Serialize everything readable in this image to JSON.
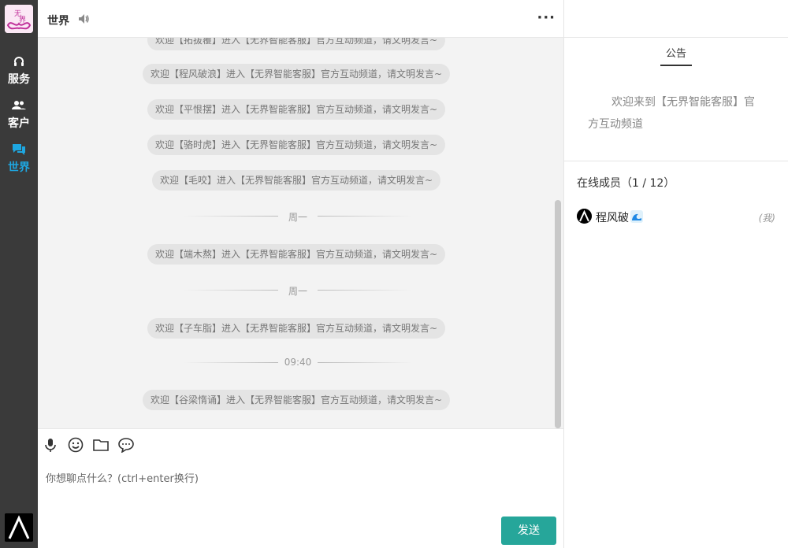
{
  "sidebar": {
    "logo_alt": "无界",
    "items": [
      {
        "label": "服务",
        "icon": "headset-icon"
      },
      {
        "label": "客户",
        "icon": "users-icon"
      },
      {
        "label": "世界",
        "icon": "chat-icon",
        "active": true
      }
    ],
    "active_color": "#1ea7e1"
  },
  "header": {
    "title": "世界",
    "sound_icon": "speaker-icon",
    "more_label": "···"
  },
  "messages": [
    {
      "type": "system",
      "text": "欢迎【拓拔覆】进入【无界智能客服】官方互动频道，请文明发言~"
    },
    {
      "type": "system",
      "text": "欢迎【程风破浪】进入【无界智能客服】官方互动频道，请文明发言~"
    },
    {
      "type": "system",
      "text": "欢迎【平恨摆】进入【无界智能客服】官方互动频道，请文明发言~"
    },
    {
      "type": "system",
      "text": "欢迎【骆时虎】进入【无界智能客服】官方互动频道，请文明发言~"
    },
    {
      "type": "system",
      "text": "欢迎【毛咬】进入【无界智能客服】官方互动频道，请文明发言~"
    },
    {
      "type": "divider",
      "text": "周一"
    },
    {
      "type": "system",
      "text": "欢迎【端木熬】进入【无界智能客服】官方互动频道，请文明发言~"
    },
    {
      "type": "divider",
      "text": "周一"
    },
    {
      "type": "system",
      "text": "欢迎【子车脂】进入【无界智能客服】官方互动频道，请文明发言~"
    },
    {
      "type": "divider",
      "text": "09:40"
    },
    {
      "type": "system",
      "text": "欢迎【谷梁惰诵】进入【无界智能客服】官方互动频道，请文明发言~"
    }
  ],
  "toolbar": {
    "icons": [
      "microphone-icon",
      "emoji-icon",
      "folder-icon",
      "comment-icon"
    ]
  },
  "composer": {
    "placeholder": "你想聊点什么？(ctrl+enter换行)",
    "send_label": "发送",
    "send_color": "#26a69a"
  },
  "panel": {
    "tab_label": "公告",
    "notice": "欢迎来到【无界智能客服】官方互动频道",
    "online_title": "在线成员（1 / 12）",
    "members": [
      {
        "name": "程风破",
        "tag": "(我)"
      }
    ]
  }
}
